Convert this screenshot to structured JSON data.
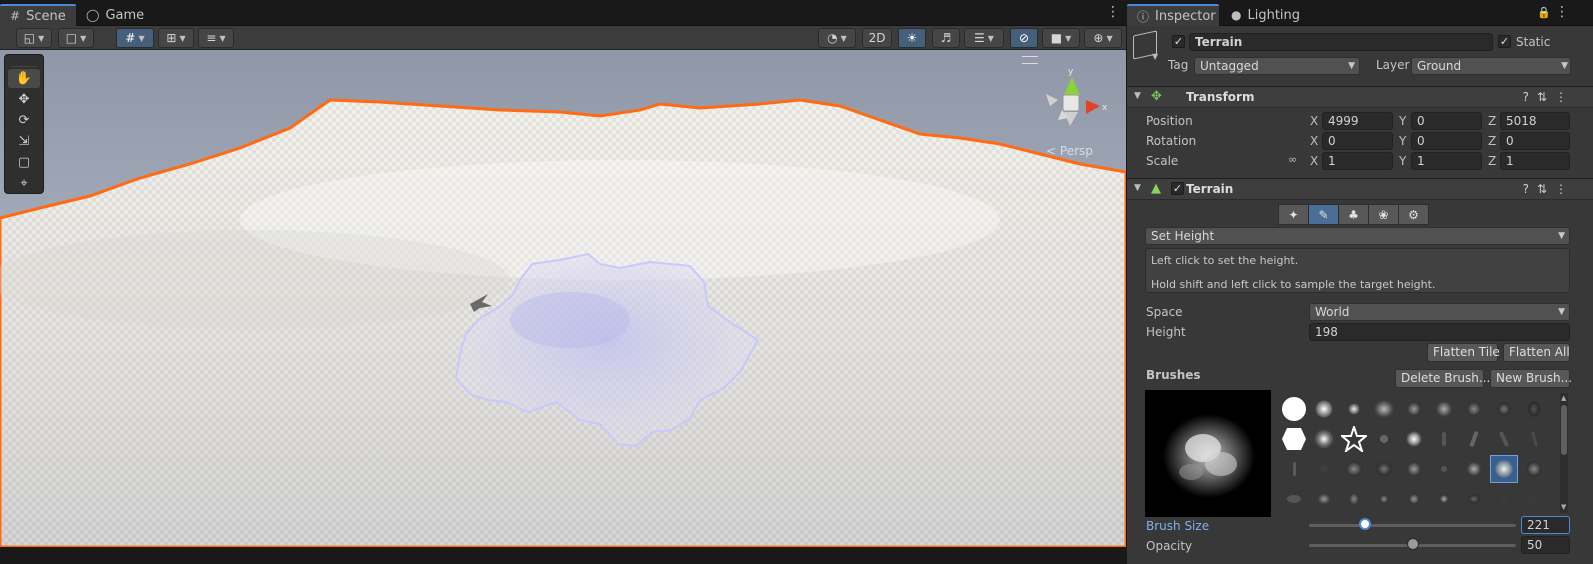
{
  "scene": {
    "tabs": [
      {
        "label": "Scene",
        "icon": "grid-icon"
      },
      {
        "label": "Game",
        "icon": "gamepad-icon"
      }
    ],
    "toolbar": {
      "mode_2d_label": "2D"
    },
    "gizmo": {
      "projection_label": "Persp",
      "axis_y": "y",
      "axis_x": "x"
    },
    "tools": [
      "hand-tool-icon",
      "move-tool-icon",
      "rotate-tool-icon",
      "scale-tool-icon",
      "rect-tool-icon",
      "transform-tool-icon"
    ],
    "colors": {
      "selection_outline": "#ff6a13",
      "brush_outline": "#c8c8ff"
    }
  },
  "inspector": {
    "tabs": [
      {
        "label": "Inspector",
        "icon": "info-icon"
      },
      {
        "label": "Lighting",
        "icon": "bulb-icon"
      }
    ],
    "object": {
      "name": "Terrain",
      "active": true,
      "static_label": "Static",
      "static": true,
      "tag_label": "Tag",
      "tag_value": "Untagged",
      "layer_label": "Layer",
      "layer_value": "Ground"
    },
    "transform": {
      "title": "Transform",
      "position_label": "Position",
      "rotation_label": "Rotation",
      "scale_label": "Scale",
      "axis_x": "X",
      "axis_y": "Y",
      "axis_z": "Z",
      "position": {
        "x": "4999",
        "y": "0",
        "z": "5018"
      },
      "rotation": {
        "x": "0",
        "y": "0",
        "z": "0"
      },
      "scale": {
        "x": "1",
        "y": "1",
        "z": "1"
      }
    },
    "terrain": {
      "title": "Terrain",
      "enabled": true,
      "tool_mode": "Set Height",
      "help_line1": "Left click to set the height.",
      "help_line2": "Hold shift and left click to sample the target height.",
      "space_label": "Space",
      "space_value": "World",
      "height_label": "Height",
      "height_value": "198",
      "flatten_tile_label": "Flatten Tile",
      "flatten_all_label": "Flatten All",
      "brushes_label": "Brushes",
      "delete_brush_label": "Delete Brush...",
      "new_brush_label": "New Brush...",
      "brush_size_label": "Brush Size",
      "brush_size_value": "221",
      "brush_size_fraction": 0.27,
      "opacity_label": "Opacity",
      "opacity_value": "50",
      "opacity_fraction": 0.5
    }
  }
}
